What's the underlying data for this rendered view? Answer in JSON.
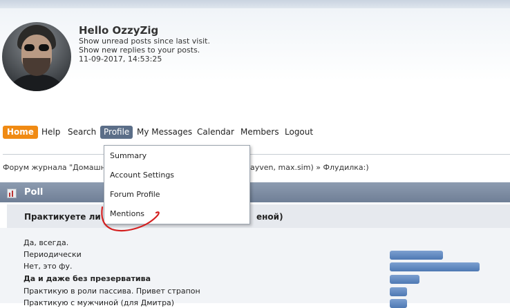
{
  "header": {
    "greeting": "Hello OzzyZig",
    "unread_link": "Show unread posts since last visit.",
    "replies_link": "Show new replies to your posts.",
    "datetime": "11-09-2017, 14:53:25"
  },
  "nav": {
    "home": "Home",
    "help": "Help",
    "search": "Search",
    "profile": "Profile",
    "messages": "My Messages",
    "calendar": "Calendar",
    "members": "Members",
    "logout": "Logout"
  },
  "profile_menu": {
    "summary": "Summary",
    "account_settings": "Account Settings",
    "forum_profile": "Forum Profile",
    "mentions": "Mentions"
  },
  "breadcrumb": {
    "left": "Форум журнала \"Домашни",
    "right": "ayven, max.sim) » Флудилка:)"
  },
  "poll": {
    "title": "Poll",
    "question_start": "Практикуете ли",
    "question_end": "еной)",
    "options": [
      {
        "label": "Да, всегда.",
        "value": 0
      },
      {
        "label": "Периодически",
        "value": 0.59
      },
      {
        "label": "Нет, это фу.",
        "value": 1.0
      },
      {
        "label": "Да и даже без презерватива",
        "value": 0.33
      },
      {
        "label": "Практикую в роли пассива. Привет страпон",
        "value": 0.19
      },
      {
        "label": "Практикую с мужчиной (для Дмитра)",
        "value": 0.19
      }
    ]
  },
  "colors": {
    "home_accent": "#f08a13",
    "profile_active": "#5b6e88",
    "poll_header": "#7a8aa0",
    "bar": "#5b82bb",
    "annotation": "#d42020"
  }
}
